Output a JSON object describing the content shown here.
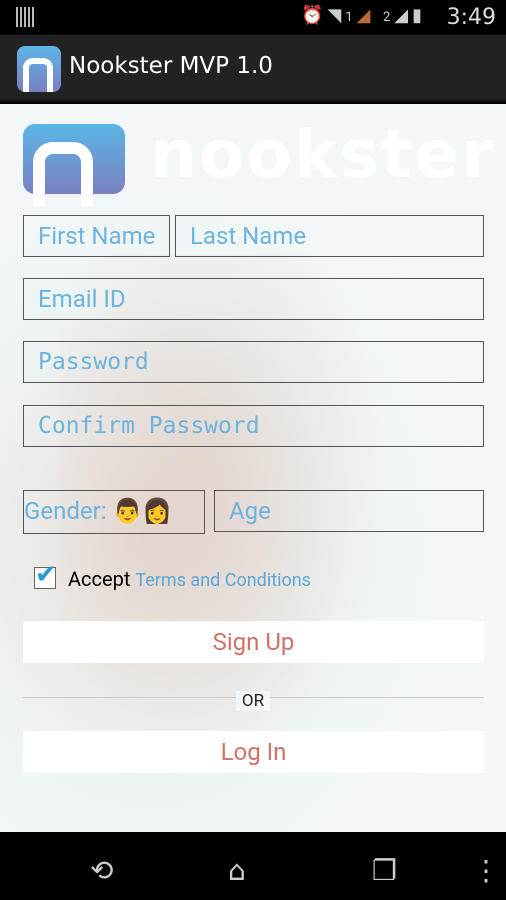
{
  "status_bar": {
    "time": "3:49",
    "icons": [
      "notification-icon",
      "alarm-icon",
      "wifi-icon",
      "signal-1-icon",
      "signal-2-icon",
      "battery-icon"
    ],
    "sim1": "1",
    "sim2": "2"
  },
  "action_bar": {
    "title": "Nookster MVP 1.0"
  },
  "brand": {
    "logo_text": "nookster"
  },
  "form": {
    "first_name_placeholder": "First Name",
    "last_name_placeholder": "Last Name",
    "email_placeholder": "Email ID",
    "password_placeholder": "Password",
    "confirm_password_placeholder": "Confirm Password",
    "gender_label": "Gender:",
    "age_placeholder": "Age",
    "accept_label": "Accept",
    "terms_link": "Terms and Conditions",
    "accept_checked": true,
    "signup_label": "Sign Up",
    "or_label": "OR",
    "login_label": "Log In"
  },
  "colors": {
    "accent": "#6cb3e0",
    "button_text": "#d0716a"
  }
}
